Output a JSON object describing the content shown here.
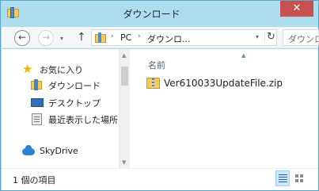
{
  "window": {
    "title": "ダウンロード",
    "close_glyph": "✕"
  },
  "navigation": {
    "back_glyph": "←",
    "forward_glyph": "→",
    "recent_glyph": "▾",
    "up_glyph": "↑",
    "refresh_glyph": "↻"
  },
  "address": {
    "crumbs": [
      "PC",
      "ダウンロ..."
    ],
    "separator": "›",
    "dropdown_glyph": "▾"
  },
  "search": {
    "placeholder": "ダウンロ"
  },
  "sidebar": {
    "items": [
      {
        "label": "お気に入り",
        "icon": "star-icon"
      },
      {
        "label": "ダウンロード",
        "icon": "downloads-folder-icon"
      },
      {
        "label": "デスクトップ",
        "icon": "desktop-icon"
      },
      {
        "label": "最近表示した場所",
        "icon": "recent-places-icon"
      },
      {
        "label": "SkyDrive",
        "icon": "skydrive-cloud-icon"
      }
    ]
  },
  "filelist": {
    "column_header": "名前",
    "sort_glyph": "▲",
    "files": [
      {
        "name": "Ver610033UpdateFile.zip",
        "icon": "zip-file-icon"
      }
    ]
  },
  "status": {
    "text": "1 個の項目"
  },
  "colors": {
    "frame": "#aeddee",
    "close_button": "#c75050",
    "selected_view": "#cce8ff"
  }
}
